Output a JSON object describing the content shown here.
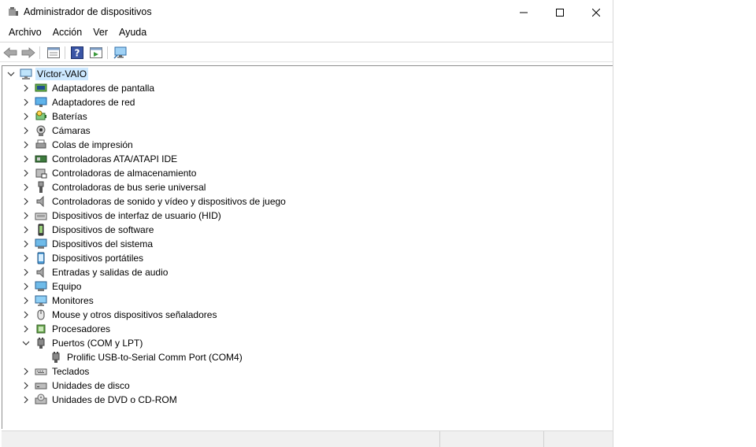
{
  "window": {
    "title": "Administrador de dispositivos"
  },
  "menu": [
    "Archivo",
    "Acción",
    "Ver",
    "Ayuda"
  ],
  "toolbar": {
    "buttons": [
      "back-icon",
      "forward-icon",
      "properties-icon",
      "help-icon",
      "update-driver-icon",
      "scan-hardware-icon"
    ]
  },
  "tree": {
    "root": "Víctor-VAIO",
    "items": [
      {
        "label": "Adaptadores de pantalla",
        "icon": "display-adapter-icon",
        "expanded": false
      },
      {
        "label": "Adaptadores de red",
        "icon": "network-adapter-icon",
        "expanded": false
      },
      {
        "label": "Baterías",
        "icon": "battery-icon",
        "expanded": false
      },
      {
        "label": "Cámaras",
        "icon": "camera-icon",
        "expanded": false
      },
      {
        "label": "Colas de impresión",
        "icon": "printer-icon",
        "expanded": false
      },
      {
        "label": "Controladoras ATA/ATAPI IDE",
        "icon": "ide-controller-icon",
        "expanded": false
      },
      {
        "label": "Controladoras de almacenamiento",
        "icon": "storage-controller-icon",
        "expanded": false
      },
      {
        "label": "Controladoras de bus serie universal",
        "icon": "usb-icon",
        "expanded": false
      },
      {
        "label": "Controladoras de sonido y vídeo y dispositivos de juego",
        "icon": "speaker-icon",
        "expanded": false
      },
      {
        "label": "Dispositivos de interfaz de usuario (HID)",
        "icon": "hid-icon",
        "expanded": false
      },
      {
        "label": "Dispositivos de software",
        "icon": "software-device-icon",
        "expanded": false
      },
      {
        "label": "Dispositivos del sistema",
        "icon": "system-device-icon",
        "expanded": false
      },
      {
        "label": "Dispositivos portátiles",
        "icon": "portable-device-icon",
        "expanded": false
      },
      {
        "label": "Entradas y salidas de audio",
        "icon": "audio-io-icon",
        "expanded": false
      },
      {
        "label": "Equipo",
        "icon": "computer-icon",
        "expanded": false
      },
      {
        "label": "Monitores",
        "icon": "monitor-icon",
        "expanded": false
      },
      {
        "label": "Mouse y otros dispositivos señaladores",
        "icon": "mouse-icon",
        "expanded": false
      },
      {
        "label": "Procesadores",
        "icon": "processor-icon",
        "expanded": false
      },
      {
        "label": "Puertos (COM y LPT)",
        "icon": "port-icon",
        "expanded": true,
        "children": [
          {
            "label": "Prolific USB-to-Serial Comm Port (COM4)",
            "icon": "port-icon"
          }
        ]
      },
      {
        "label": "Teclados",
        "icon": "keyboard-icon",
        "expanded": false
      },
      {
        "label": "Unidades de disco",
        "icon": "disk-drive-icon",
        "expanded": false
      },
      {
        "label": "Unidades de DVD o CD-ROM",
        "icon": "dvd-drive-icon",
        "expanded": false
      }
    ]
  }
}
